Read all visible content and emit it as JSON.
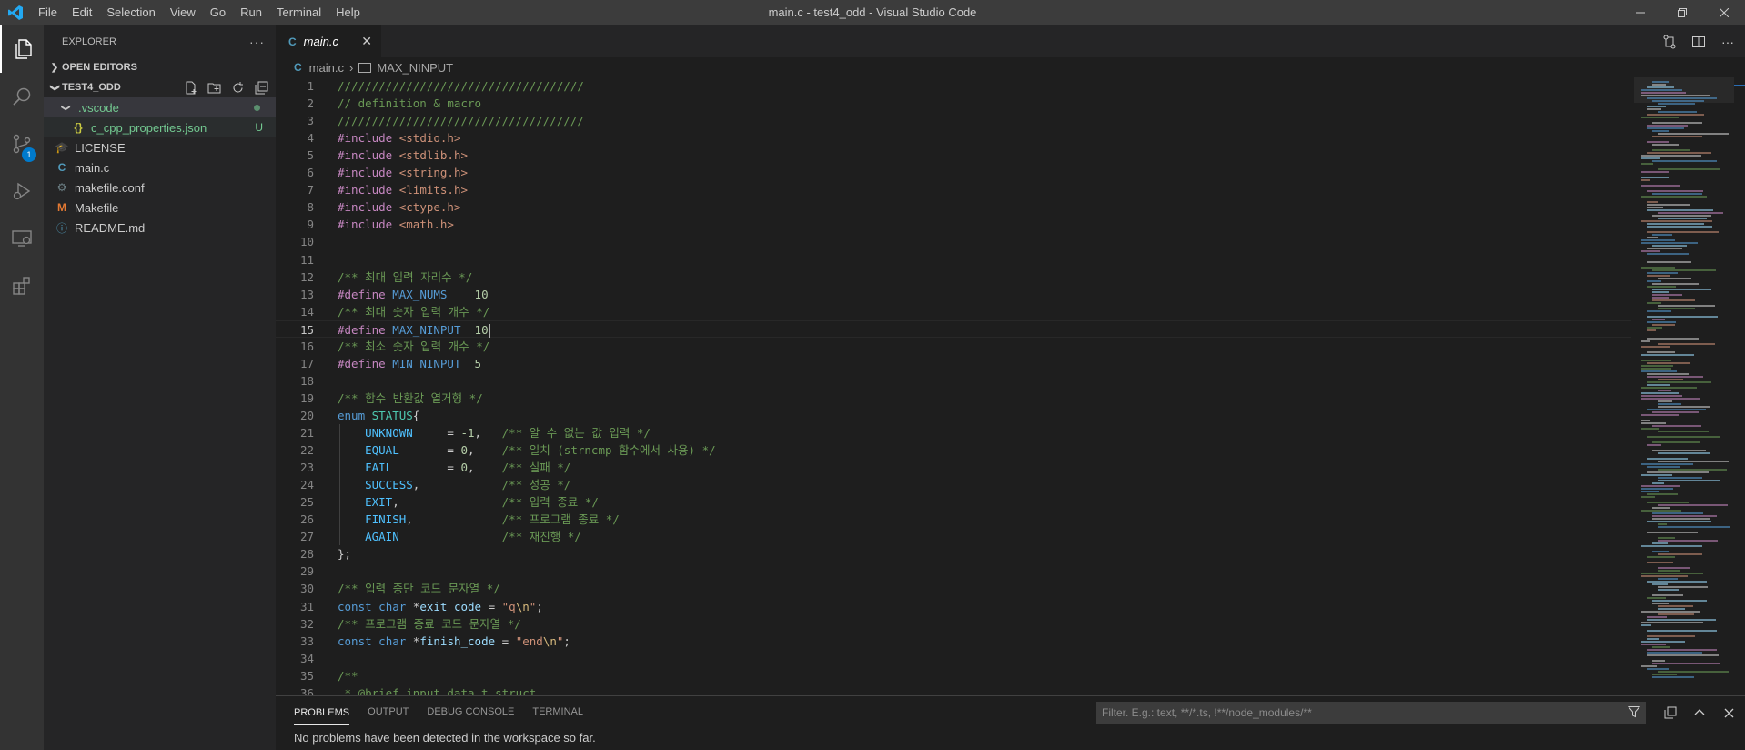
{
  "window": {
    "title": "main.c - test4_odd - Visual Studio Code"
  },
  "menu": [
    "File",
    "Edit",
    "Selection",
    "View",
    "Go",
    "Run",
    "Terminal",
    "Help"
  ],
  "activity": {
    "scm_badge": "1"
  },
  "sidebar": {
    "header": "EXPLORER",
    "more": "···",
    "open_editors": "OPEN EDITORS",
    "folder": "TEST4_ODD",
    "tree": [
      {
        "label": ".vscode",
        "icon": "folder-open",
        "status": "dot"
      },
      {
        "label": "c_cpp_properties.json",
        "icon": "json-icon",
        "status": "U"
      },
      {
        "label": "LICENSE",
        "icon": "license-icon",
        "status": ""
      },
      {
        "label": "main.c",
        "icon": "c-file-icon",
        "status": ""
      },
      {
        "label": "makefile.conf",
        "icon": "gear-icon",
        "status": ""
      },
      {
        "label": "Makefile",
        "icon": "makefile-icon",
        "status": ""
      },
      {
        "label": "README.md",
        "icon": "info-icon",
        "status": ""
      }
    ]
  },
  "tab": {
    "icon": "C",
    "label": "main.c",
    "close": "✕"
  },
  "breadcrumb": {
    "file_icon": "C",
    "file": "main.c",
    "symbol": "MAX_NINPUT"
  },
  "code": [
    "////////////////////////////////////",
    "// definition & macro",
    "////////////////////////////////////",
    "#include <stdio.h>",
    "#include <stdlib.h>",
    "#include <string.h>",
    "#include <limits.h>",
    "#include <ctype.h>",
    "#include <math.h>",
    "",
    "",
    "/** 최대 입력 자리수 */",
    "#define MAX_NUMS    10",
    "/** 최대 숫자 입력 개수 */",
    "#define MAX_NINPUT  10",
    "/** 최소 숫자 입력 개수 */",
    "#define MIN_NINPUT  5",
    "",
    "/** 함수 반환값 열거형 */",
    "enum STATUS{",
    "    UNKNOWN     = -1,   /** 알 수 없는 값 입력 */",
    "    EQUAL       = 0,    /** 일치 (strncmp 함수에서 사용) */",
    "    FAIL        = 0,    /** 실패 */",
    "    SUCCESS,            /** 성공 */",
    "    EXIT,               /** 입력 종료 */",
    "    FINISH,             /** 프로그램 종료 */",
    "    AGAIN               /** 재진행 */",
    "};",
    "",
    "/** 입력 중단 코드 문자열 */",
    "const char *exit_code = \"q\\n\";",
    "/** 프로그램 종료 코드 문자열 */",
    "const char *finish_code = \"end\\n\";",
    "",
    "/**",
    " * @brief input data t struct"
  ],
  "panel": {
    "tabs": [
      "PROBLEMS",
      "OUTPUT",
      "DEBUG CONSOLE",
      "TERMINAL"
    ],
    "filter_placeholder": "Filter. E.g.: text, **/*.ts, !**/node_modules/**",
    "message": "No problems have been detected in the workspace so far."
  },
  "colors": {
    "accent": "#007acc",
    "comment": "#6a9955",
    "preprocessor": "#c586c0",
    "string": "#ce9178",
    "keyword": "#569cd6",
    "enum_member": "#4fc1ff",
    "number": "#b5cea8"
  }
}
